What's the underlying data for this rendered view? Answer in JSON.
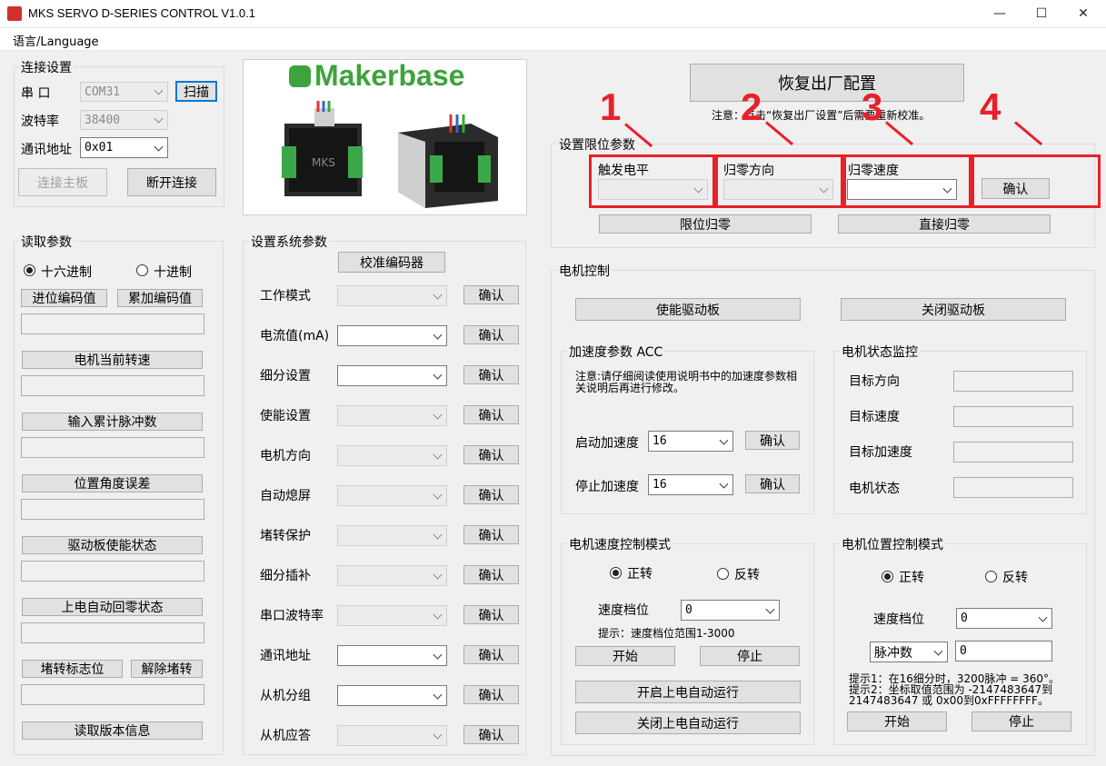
{
  "window": {
    "title": "MKS SERVO D-SERIES CONTROL V1.0.1"
  },
  "menu": {
    "language": "语言/Language"
  },
  "connection": {
    "group_label": "连接设置",
    "port_label": "串  口",
    "port_value": "COM31",
    "scan_button": "扫描",
    "baud_label": "波特率",
    "baud_value": "38400",
    "address_label": "通讯地址",
    "address_value": "0x01",
    "connect_button": "连接主板",
    "disconnect_button": "断开连接"
  },
  "logo": {
    "brand": "Makerbase",
    "small": "MKS"
  },
  "factory": {
    "reset_button": "恢复出厂配置",
    "note": "注意：点击“恢复出厂设置”后需要重新校准。"
  },
  "limit": {
    "group_label": "设置限位参数",
    "trigger_label": "触发电平",
    "direction_label": "归零方向",
    "speed_label": "归零速度",
    "confirm_button": "确认",
    "limit_home_button": "限位归零",
    "direct_home_button": "直接归零"
  },
  "annotations": [
    "1",
    "2",
    "3",
    "4"
  ],
  "read": {
    "group_label": "读取参数",
    "hex_label": "十六进制",
    "dec_label": "十进制",
    "carry_button": "进位编码值",
    "accum_button": "累加编码值",
    "speed_button": "电机当前转速",
    "pulses_button": "输入累计脉冲数",
    "angle_error_button": "位置角度误差",
    "enable_state_button": "驱动板使能状态",
    "auto_home_button": "上电自动回零状态",
    "stall_flag_button": "堵转标志位",
    "release_stall_button": "解除堵转",
    "version_button": "读取版本信息"
  },
  "system": {
    "group_label": "设置系统参数",
    "calibrate_button": "校准编码器",
    "confirm": "确认",
    "rows": [
      {
        "label": "工作模式"
      },
      {
        "label": "电流值(mA)"
      },
      {
        "label": "细分设置"
      },
      {
        "label": "使能设置"
      },
      {
        "label": "电机方向"
      },
      {
        "label": "自动熄屏"
      },
      {
        "label": "堵转保护"
      },
      {
        "label": "细分插补"
      },
      {
        "label": "串口波特率"
      },
      {
        "label": "通讯地址"
      },
      {
        "label": "从机分组"
      },
      {
        "label": "从机应答"
      }
    ]
  },
  "motor": {
    "group_label": "电机控制",
    "enable_button": "使能驱动板",
    "disable_button": "关闭驱动板",
    "acc": {
      "group_label": "加速度参数 ACC",
      "note": "注意:请仔细阅读使用说明书中的加速度参数相关说明后再进行修改。",
      "start_label": "启动加速度",
      "start_value": "16",
      "stop_label": "停止加速度",
      "stop_value": "16",
      "confirm": "确认"
    },
    "monitor": {
      "group_label": "电机状态监控",
      "target_dir": "目标方向",
      "target_speed": "目标速度",
      "target_acc": "目标加速度",
      "motor_state": "电机状态"
    },
    "speed_mode": {
      "group_label": "电机速度控制模式",
      "forward": "正转",
      "reverse": "反转",
      "gear_label": "速度档位",
      "gear_value": "0",
      "hint": "提示：速度档位范围1-3000",
      "start": "开始",
      "stop": "停止",
      "auto_on": "开启上电自动运行",
      "auto_off": "关闭上电自动运行"
    },
    "pos_mode": {
      "group_label": "电机位置控制模式",
      "forward": "正转",
      "reverse": "反转",
      "gear_label": "速度档位",
      "gear_value": "0",
      "unit_value": "脉冲数",
      "pulse_value": "0",
      "hint1": "提示1：在16细分时，3200脉冲 = 360°。",
      "hint2": "提示2：坐标取值范围为 -2147483647到",
      "hint3": "2147483647 或 0x00到0xFFFFFFFF。",
      "start": "开始",
      "stop": "停止"
    }
  }
}
